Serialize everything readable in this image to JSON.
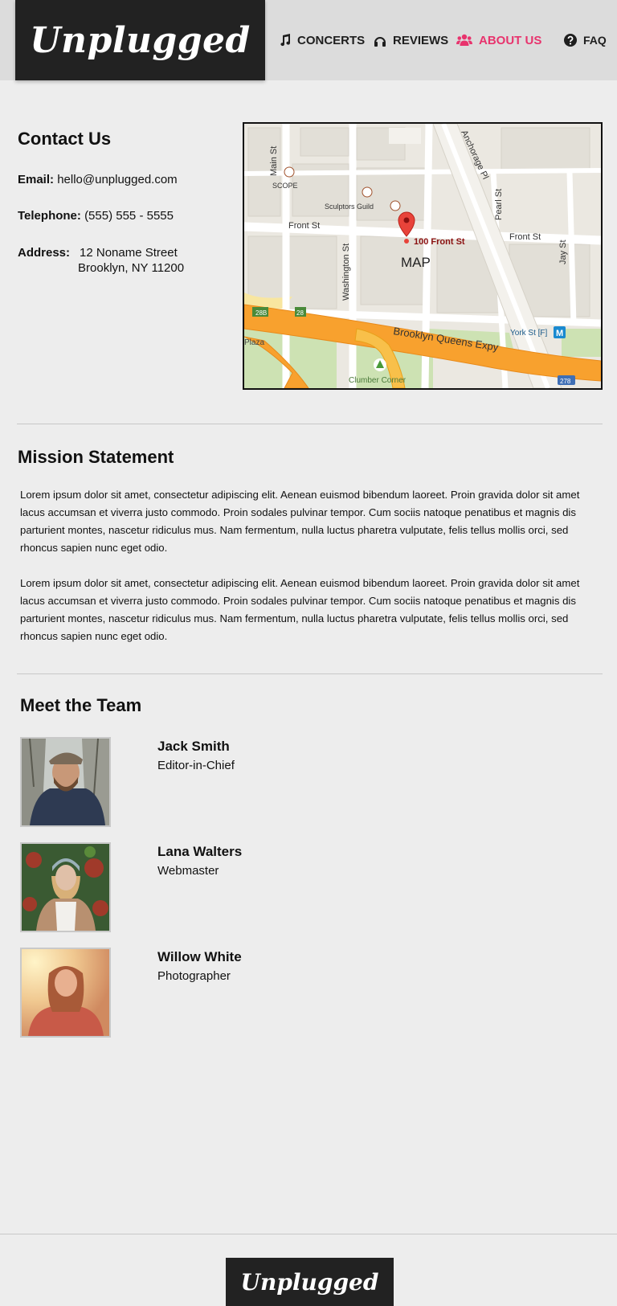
{
  "brand": {
    "logo": "Unplugged",
    "footer_logo": "Unplugged",
    "accent": "#e8336d",
    "dark": "#222222"
  },
  "nav": {
    "items": [
      {
        "label": "CONCERTS",
        "icon": "music-note-icon"
      },
      {
        "label": "REVIEWS",
        "icon": "headphones-icon"
      },
      {
        "label": "ABOUT US",
        "icon": "users-icon",
        "active": true
      },
      {
        "label": "FAQ",
        "icon": "question-circle-icon"
      }
    ]
  },
  "contact": {
    "title": "Contact Us",
    "email_label": "Email:",
    "email": "hello@unplugged.com",
    "phone_label": "Telephone:",
    "phone": "(555) 555 - 5555",
    "address_label": "Address:",
    "address_line1": "12 Noname Street",
    "address_line2": "Brooklyn, NY 11200"
  },
  "map": {
    "label": "MAP",
    "pin_label": "100 Front St",
    "streets": [
      "Main St",
      "Front St",
      "Front St",
      "Washington St",
      "Anchorage Pl",
      "Pearl St",
      "Jay St",
      "Brooklyn Queens Expy"
    ],
    "places": [
      "SCOPE",
      "Sculptors Guild",
      "York St [F]",
      "Clumber Corner",
      "Plaza"
    ],
    "shields": [
      "28B",
      "28",
      "278"
    ],
    "subway_badge": "M"
  },
  "mission": {
    "title": "Mission Statement",
    "paragraphs": [
      "Lorem ipsum dolor sit amet, consectetur adipiscing elit. Aenean euismod bibendum laoreet. Proin gravida dolor sit amet lacus accumsan et viverra justo commodo. Proin sodales pulvinar tempor. Cum sociis natoque penatibus et magnis dis parturient montes, nascetur ridiculus mus. Nam fermentum, nulla luctus pharetra vulputate, felis tellus mollis orci, sed rhoncus sapien nunc eget odio.",
      "Lorem ipsum dolor sit amet, consectetur adipiscing elit. Aenean euismod bibendum laoreet. Proin gravida dolor sit amet lacus accumsan et viverra justo commodo. Proin sodales pulvinar tempor. Cum sociis natoque penatibus et magnis dis parturient montes, nascetur ridiculus mus. Nam fermentum, nulla luctus pharetra vulputate, felis tellus mollis orci, sed rhoncus sapien nunc eget odio."
    ]
  },
  "team": {
    "title": "Meet the Team",
    "members": [
      {
        "name": "Jack Smith",
        "role": "Editor-in-Chief"
      },
      {
        "name": "Lana Walters",
        "role": "Webmaster"
      },
      {
        "name": "Willow White",
        "role": "Photographer"
      }
    ]
  }
}
